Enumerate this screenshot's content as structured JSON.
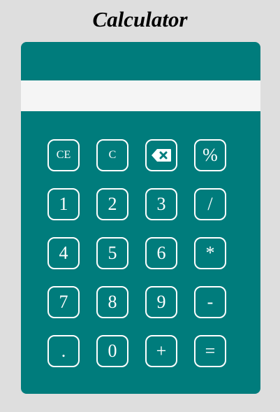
{
  "app": {
    "title": "Calculator"
  },
  "display": {
    "value": ""
  },
  "keys": {
    "ce": "CE",
    "c": "C",
    "backspace_icon": "backspace-icon",
    "percent": "%",
    "one": "1",
    "two": "2",
    "three": "3",
    "divide": "/",
    "four": "4",
    "five": "5",
    "six": "6",
    "multiply": "*",
    "seven": "7",
    "eight": "8",
    "nine": "9",
    "minus": "-",
    "dot": ".",
    "zero": "0",
    "plus": "+",
    "equals": "="
  },
  "colors": {
    "panel": "#007c7c",
    "display": "#f5f5f5",
    "page_background": "#dedede",
    "key_border": "#ffffff"
  }
}
